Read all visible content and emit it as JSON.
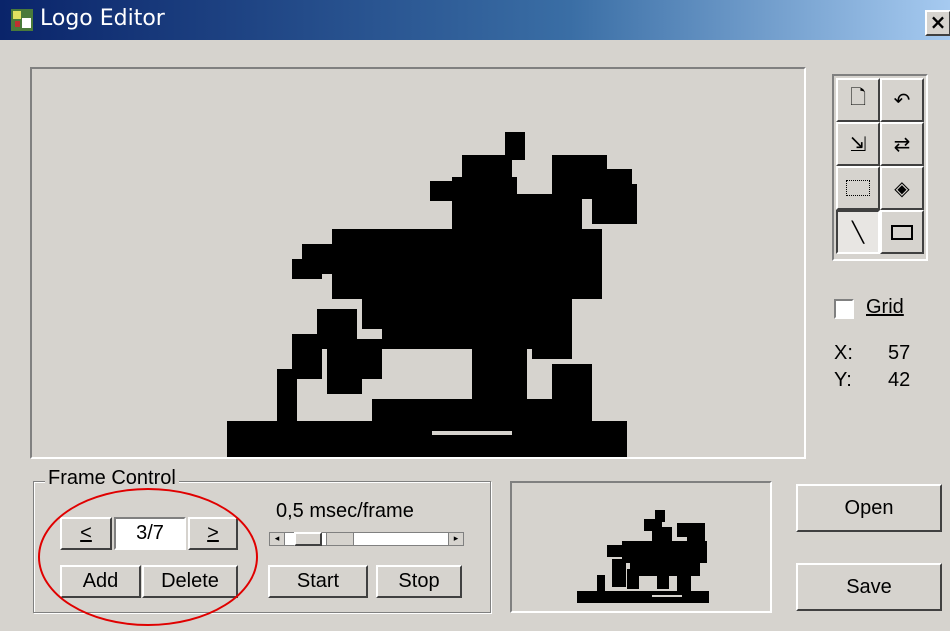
{
  "window": {
    "title": "Logo Editor",
    "close_label": "×"
  },
  "options": {
    "grid_label": "Grid",
    "grid_checked": false
  },
  "coords": {
    "x_label": "X:",
    "x_value": "57",
    "y_label": "Y:",
    "y_value": "42"
  },
  "frame_control": {
    "title": "Frame Control",
    "prev_label": "<",
    "next_label": ">",
    "frame_value": "3/7",
    "add_label": "Add",
    "delete_label": "Delete",
    "speed_label": "0,5 msec/frame",
    "start_label": "Start",
    "stop_label": "Stop"
  },
  "buttons": {
    "open_label": "Open",
    "save_label": "Save"
  },
  "toolbox": [
    "new-icon",
    "undo-icon",
    "import-icon",
    "swap-icon",
    "select-rect-icon",
    "fill-icon",
    "line-icon",
    "rectangle-icon"
  ]
}
